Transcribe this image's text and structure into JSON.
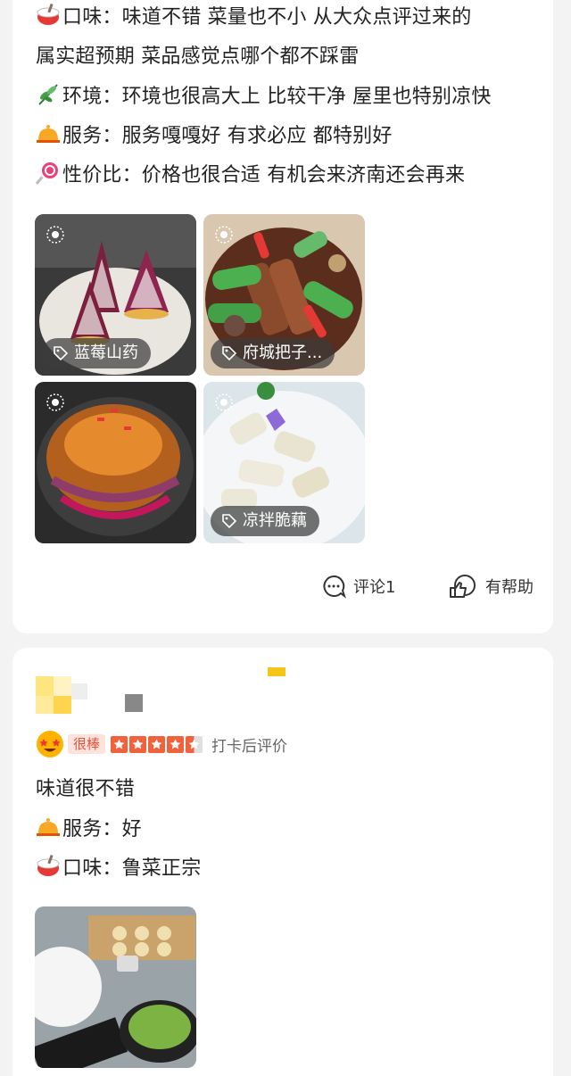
{
  "review1": {
    "lines": [
      {
        "icon": "rice-bowl-icon",
        "text": "口味：味道不错 菜量也不小 从大众点评过来的"
      },
      {
        "icon": "",
        "text": "属实超预期 菜品感觉点哪个都不踩雷"
      },
      {
        "icon": "herb-icon",
        "text": "环境：环境也很高大上 比较干净 屋里也特别凉快"
      },
      {
        "icon": "service-bell-icon",
        "text": "服务：服务嘎嘎好 有求必应 都特别好"
      },
      {
        "icon": "lollipop-icon",
        "text": "性价比：价格也很合适 有机会来济南还会再来"
      }
    ],
    "photos": [
      {
        "tag": "蓝莓山药"
      },
      {
        "tag": "府城把子..."
      },
      {
        "tag": ""
      },
      {
        "tag": "凉拌脆藕"
      }
    ],
    "comment_label": "评论1",
    "helpful_label": "有帮助"
  },
  "review2": {
    "rating_word": "很棒",
    "stars": 4.5,
    "rating_note": "打卡后评价",
    "lines": [
      {
        "icon": "",
        "text": "味道很不错"
      },
      {
        "icon": "service-bell-icon",
        "text": "服务：好"
      },
      {
        "icon": "rice-bowl-icon",
        "text": "口味：鲁菜正宗"
      }
    ]
  },
  "colors": {
    "accent": "#f0623c",
    "tag_bg": "#3c3c3c",
    "page_bg": "#f3f3f3"
  }
}
